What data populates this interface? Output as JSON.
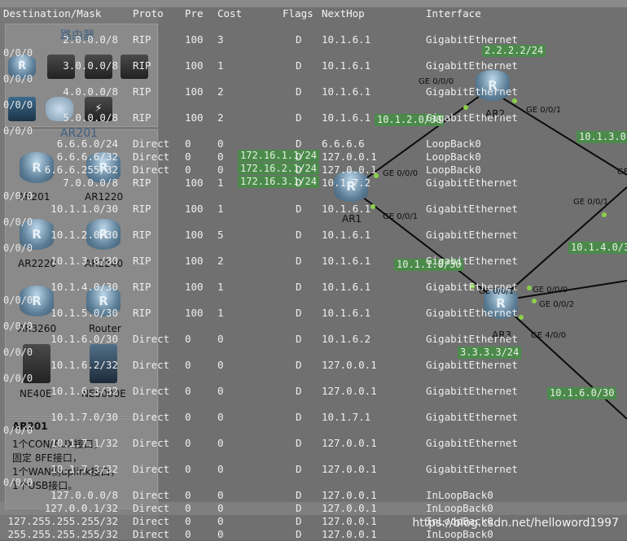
{
  "left_panel": {
    "category_title": "路由器",
    "selected_title": "AR201",
    "devices": [
      "AR201",
      "AR1220",
      "AR2220",
      "AR2240",
      "AR3260",
      "Router",
      "NE40E",
      "NE5000E"
    ],
    "side_values": [
      "0/0/0",
      "0/0/0",
      "0/0/0",
      "0/0/0",
      "0/0/0",
      "0/0/0",
      "0/0/0",
      "0/0/0",
      "0/0/0",
      "0/0/0",
      "0/0/0",
      "0/0/0",
      "0/0/0"
    ],
    "info": {
      "title": "AR201",
      "lines": [
        "1个CON/AUX接口，",
        "固定 8FE接口，",
        "1个WAN侧uplink接口，",
        "1个USB接口。"
      ]
    }
  },
  "topology": {
    "routers": [
      {
        "name": "AR1",
        "symbol": "R"
      },
      {
        "name": "AR2",
        "symbol": "R"
      },
      {
        "name": "AR3",
        "symbol": "R"
      }
    ],
    "ports": [
      "GE 0/0/0",
      "GE 0/0/1",
      "GE 0/0/0",
      "GE 0/0/1",
      "GE 0/0/0",
      "GE 0/0/1",
      "GE 0/0/2",
      "GE 4/0/0",
      "GE 0/0/1",
      "GE"
    ],
    "ip_labels": [
      "2.2.2.2/24",
      "10.1.2.0/30",
      "10.1.3.0",
      "172.16.1.1/24",
      "172.16.2.1/24",
      "172.16.3.1/24",
      "10.1.1.0/30",
      "10.1.4.0/3",
      "3.3.3.3/24",
      "10.1.6.0/30"
    ],
    "link_color": "#0a0a0a",
    "ip_box_color": "#4c8a4c"
  },
  "routing_table": {
    "headers": {
      "dest": "Destination/Mask",
      "proto": "Proto",
      "pre": "Pre",
      "cost": "Cost",
      "flags": "Flags",
      "nexthop": "NextHop",
      "iface": "Interface"
    },
    "rows": [
      {
        "dest": "2.0.0.0/8",
        "proto": "RIP",
        "pre": "100",
        "cost": "3",
        "flags": "D",
        "nexthop": "10.1.6.1",
        "iface": "GigabitEthernet"
      },
      {
        "dest": "3.0.0.0/8",
        "proto": "RIP",
        "pre": "100",
        "cost": "1",
        "flags": "D",
        "nexthop": "10.1.6.1",
        "iface": "GigabitEthernet"
      },
      {
        "dest": "4.0.0.0/8",
        "proto": "RIP",
        "pre": "100",
        "cost": "2",
        "flags": "D",
        "nexthop": "10.1.6.1",
        "iface": "GigabitEthernet"
      },
      {
        "dest": "5.0.0.0/8",
        "proto": "RIP",
        "pre": "100",
        "cost": "2",
        "flags": "D",
        "nexthop": "10.1.6.1",
        "iface": "GigabitEthernet"
      },
      {
        "dest": "6.6.6.0/24",
        "proto": "Direct",
        "pre": "0",
        "cost": "0",
        "flags": "D",
        "nexthop": "6.6.6.6",
        "iface": "LoopBack0"
      },
      {
        "dest": "6.6.6.6/32",
        "proto": "Direct",
        "pre": "0",
        "cost": "0",
        "flags": "D",
        "nexthop": "127.0.0.1",
        "iface": "LoopBack0"
      },
      {
        "dest": "6.6.6.255/32",
        "proto": "Direct",
        "pre": "0",
        "cost": "0",
        "flags": "D",
        "nexthop": "127.0.0.1",
        "iface": "LoopBack0"
      },
      {
        "dest": "7.0.0.0/8",
        "proto": "RIP",
        "pre": "100",
        "cost": "1",
        "flags": "D",
        "nexthop": "10.1.7.2",
        "iface": "GigabitEthernet"
      },
      {
        "dest": "10.1.1.0/30",
        "proto": "RIP",
        "pre": "100",
        "cost": "1",
        "flags": "D",
        "nexthop": "10.1.6.1",
        "iface": "GigabitEthernet"
      },
      {
        "dest": "10.1.2.0/30",
        "proto": "RIP",
        "pre": "100",
        "cost": "5",
        "flags": "D",
        "nexthop": "10.1.6.1",
        "iface": "GigabitEthernet"
      },
      {
        "dest": "10.1.3.0/30",
        "proto": "RIP",
        "pre": "100",
        "cost": "2",
        "flags": "D",
        "nexthop": "10.1.6.1",
        "iface": "GigabitEthernet"
      },
      {
        "dest": "10.1.4.0/30",
        "proto": "RIP",
        "pre": "100",
        "cost": "1",
        "flags": "D",
        "nexthop": "10.1.6.1",
        "iface": "GigabitEthernet"
      },
      {
        "dest": "10.1.5.0/30",
        "proto": "RIP",
        "pre": "100",
        "cost": "1",
        "flags": "D",
        "nexthop": "10.1.6.1",
        "iface": "GigabitEthernet"
      },
      {
        "dest": "10.1.6.0/30",
        "proto": "Direct",
        "pre": "0",
        "cost": "0",
        "flags": "D",
        "nexthop": "10.1.6.2",
        "iface": "GigabitEthernet"
      },
      {
        "dest": "10.1.6.2/32",
        "proto": "Direct",
        "pre": "0",
        "cost": "0",
        "flags": "D",
        "nexthop": "127.0.0.1",
        "iface": "GigabitEthernet"
      },
      {
        "dest": "10.1.6.3/32",
        "proto": "Direct",
        "pre": "0",
        "cost": "0",
        "flags": "D",
        "nexthop": "127.0.0.1",
        "iface": "GigabitEthernet"
      },
      {
        "dest": "10.1.7.0/30",
        "proto": "Direct",
        "pre": "0",
        "cost": "0",
        "flags": "D",
        "nexthop": "10.1.7.1",
        "iface": "GigabitEthernet"
      },
      {
        "dest": "10.1.7.1/32",
        "proto": "Direct",
        "pre": "0",
        "cost": "0",
        "flags": "D",
        "nexthop": "127.0.0.1",
        "iface": "GigabitEthernet"
      },
      {
        "dest": "10.1.7.3/32",
        "proto": "Direct",
        "pre": "0",
        "cost": "0",
        "flags": "D",
        "nexthop": "127.0.0.1",
        "iface": "GigabitEthernet"
      },
      {
        "dest": "127.0.0.0/8",
        "proto": "Direct",
        "pre": "0",
        "cost": "0",
        "flags": "D",
        "nexthop": "127.0.0.1",
        "iface": "InLoopBack0"
      },
      {
        "dest": "127.0.0.1/32",
        "proto": "Direct",
        "pre": "0",
        "cost": "0",
        "flags": "D",
        "nexthop": "127.0.0.1",
        "iface": "InLoopBack0"
      },
      {
        "dest": "127.255.255.255/32",
        "proto": "Direct",
        "pre": "0",
        "cost": "0",
        "flags": "D",
        "nexthop": "127.0.0.1",
        "iface": "InLoopBack0"
      },
      {
        "dest": "255.255.255.255/32",
        "proto": "Direct",
        "pre": "0",
        "cost": "0",
        "flags": "D",
        "nexthop": "127.0.0.1",
        "iface": "InLoopBack0"
      }
    ],
    "highlight_row": 20
  },
  "watermark": "https://blog.csdn.net/helloword1997"
}
